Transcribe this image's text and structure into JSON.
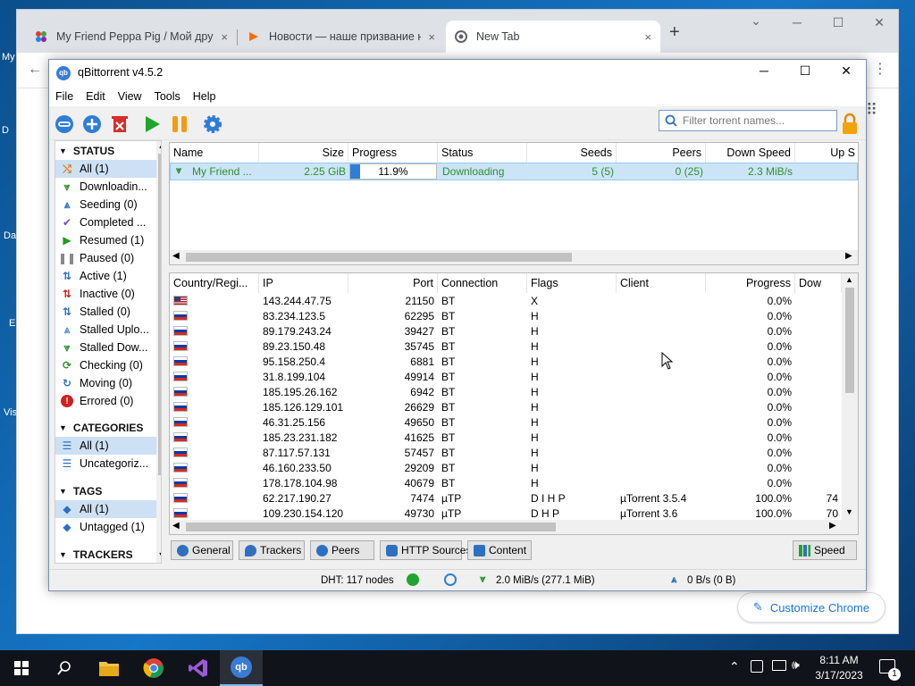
{
  "desktop": {
    "icons": [
      "My",
      "D",
      "Da",
      "E",
      "Vis"
    ]
  },
  "chrome": {
    "tabs": [
      {
        "title": "My Friend Peppa Pig / Мой друг",
        "close": "×"
      },
      {
        "title": "Новости — наше призвание на",
        "close": "×"
      },
      {
        "title": "New Tab",
        "close": "×"
      }
    ],
    "new_tab": "+",
    "customize": "Customize Chrome",
    "window_buttons": {
      "min": "─",
      "max": "☐",
      "close": "✕",
      "dropdown": "⌄"
    },
    "menu": "⋮"
  },
  "qb": {
    "title": "qBittorrent v4.5.2",
    "window_buttons": {
      "min": "─",
      "max": "☐",
      "close": "✕"
    },
    "menu": [
      "File",
      "Edit",
      "View",
      "Tools",
      "Help"
    ],
    "search_placeholder": "Filter torrent names...",
    "sidebar": {
      "status_header": "STATUS",
      "status": [
        {
          "label": "All (1)",
          "icon": "all-icon",
          "color": "#e07a00"
        },
        {
          "label": "Downloadin...",
          "icon": "downloading-icon",
          "color": "#2f8f2f"
        },
        {
          "label": "Seeding (0)",
          "icon": "seeding-icon",
          "color": "#2e6fc2"
        },
        {
          "label": "Completed ...",
          "icon": "completed-icon",
          "color": "#7a49c8"
        },
        {
          "label": "Resumed (1)",
          "icon": "resumed-icon",
          "color": "#1e9e1e"
        },
        {
          "label": "Paused (0)",
          "icon": "paused-icon",
          "color": "#888888"
        },
        {
          "label": "Active (1)",
          "icon": "active-icon",
          "color": "#2e6fc2"
        },
        {
          "label": "Inactive (0)",
          "icon": "inactive-icon",
          "color": "#d02020"
        },
        {
          "label": "Stalled (0)",
          "icon": "stalled-icon",
          "color": "#2e6fc2"
        },
        {
          "label": "Stalled Uplo...",
          "icon": "stalled-upload-icon",
          "color": "#5b8fd6"
        },
        {
          "label": "Stalled Dow...",
          "icon": "stalled-download-icon",
          "color": "#2f8f2f"
        },
        {
          "label": "Checking (0)",
          "icon": "checking-icon",
          "color": "#2f8f2f"
        },
        {
          "label": "Moving (0)",
          "icon": "moving-icon",
          "color": "#2e6fc2"
        },
        {
          "label": "Errored (0)",
          "icon": "errored-icon",
          "color": "#d02020"
        }
      ],
      "categories_header": "CATEGORIES",
      "categories": [
        {
          "label": "All (1)"
        },
        {
          "label": "Uncategoriz..."
        }
      ],
      "tags_header": "TAGS",
      "tags": [
        {
          "label": "All (1)"
        },
        {
          "label": "Untagged (1)"
        }
      ],
      "trackers_header": "TRACKERS"
    },
    "torrent_headers": [
      "Name",
      "Size",
      "Progress",
      "Status",
      "Seeds",
      "Peers",
      "Down Speed",
      "Up S"
    ],
    "torrent": {
      "name": "My Friend ...",
      "size": "2.25 GiB",
      "progress": "11.9%",
      "progress_value": 0.119,
      "status": "Downloading",
      "seeds": "5 (5)",
      "peers": "0 (25)",
      "down_speed": "2.3 MiB/s"
    },
    "peer_headers": [
      "Country/Regi...",
      "IP",
      "Port",
      "Connection",
      "Flags",
      "Client",
      "Progress",
      "Dow"
    ],
    "peers": [
      {
        "flag": "us",
        "ip": "143.244.47.75",
        "port": "21150",
        "conn": "BT",
        "flags": "X",
        "client": "",
        "progress": "0.0%",
        "down": ""
      },
      {
        "flag": "ru",
        "ip": "83.234.123.5",
        "port": "62295",
        "conn": "BT",
        "flags": "H",
        "client": "",
        "progress": "0.0%",
        "down": ""
      },
      {
        "flag": "ru",
        "ip": "89.179.243.24",
        "port": "39427",
        "conn": "BT",
        "flags": "H",
        "client": "",
        "progress": "0.0%",
        "down": ""
      },
      {
        "flag": "ru",
        "ip": "89.23.150.48",
        "port": "35745",
        "conn": "BT",
        "flags": "H",
        "client": "",
        "progress": "0.0%",
        "down": ""
      },
      {
        "flag": "ru",
        "ip": "95.158.250.4",
        "port": "6881",
        "conn": "BT",
        "flags": "H",
        "client": "",
        "progress": "0.0%",
        "down": ""
      },
      {
        "flag": "ru",
        "ip": "31.8.199.104",
        "port": "49914",
        "conn": "BT",
        "flags": "H",
        "client": "",
        "progress": "0.0%",
        "down": ""
      },
      {
        "flag": "ru",
        "ip": "185.195.26.162",
        "port": "6942",
        "conn": "BT",
        "flags": "H",
        "client": "",
        "progress": "0.0%",
        "down": ""
      },
      {
        "flag": "ru",
        "ip": "185.126.129.101",
        "port": "26629",
        "conn": "BT",
        "flags": "H",
        "client": "",
        "progress": "0.0%",
        "down": ""
      },
      {
        "flag": "ru",
        "ip": "46.31.25.156",
        "port": "49650",
        "conn": "BT",
        "flags": "H",
        "client": "",
        "progress": "0.0%",
        "down": ""
      },
      {
        "flag": "ru",
        "ip": "185.23.231.182",
        "port": "41625",
        "conn": "BT",
        "flags": "H",
        "client": "",
        "progress": "0.0%",
        "down": ""
      },
      {
        "flag": "ru",
        "ip": "87.117.57.131",
        "port": "57457",
        "conn": "BT",
        "flags": "H",
        "client": "",
        "progress": "0.0%",
        "down": ""
      },
      {
        "flag": "ru",
        "ip": "46.160.233.50",
        "port": "29209",
        "conn": "BT",
        "flags": "H",
        "client": "",
        "progress": "0.0%",
        "down": ""
      },
      {
        "flag": "ru",
        "ip": "178.178.104.98",
        "port": "40679",
        "conn": "BT",
        "flags": "H",
        "client": "",
        "progress": "0.0%",
        "down": ""
      },
      {
        "flag": "ru",
        "ip": "62.217.190.27",
        "port": "7474",
        "conn": "µTP",
        "flags": "D I H P",
        "client": "µTorrent 3.5.4",
        "progress": "100.0%",
        "down": "74"
      },
      {
        "flag": "ru",
        "ip": "109.230.154.120",
        "port": "49730",
        "conn": "µTP",
        "flags": "D H P",
        "client": "µTorrent 3.6",
        "progress": "100.0%",
        "down": "70"
      }
    ],
    "bottom_tabs": [
      {
        "label": "General",
        "color": "#2e6fc2"
      },
      {
        "label": "Trackers",
        "color": "#2e6fc2"
      },
      {
        "label": "Peers",
        "color": "#2e6fc2"
      },
      {
        "label": "HTTP Sources",
        "color": "#2e6fc2"
      },
      {
        "label": "Content",
        "color": "#2e6fc2"
      }
    ],
    "speed_tab": "Speed",
    "status_bar": {
      "dht": "DHT: 117 nodes",
      "down": "2.0 MiB/s (277.1 MiB)",
      "up": "0 B/s (0 B)"
    }
  },
  "taskbar": {
    "time": "8:11 AM",
    "date": "3/17/2023",
    "notifications": "1"
  }
}
